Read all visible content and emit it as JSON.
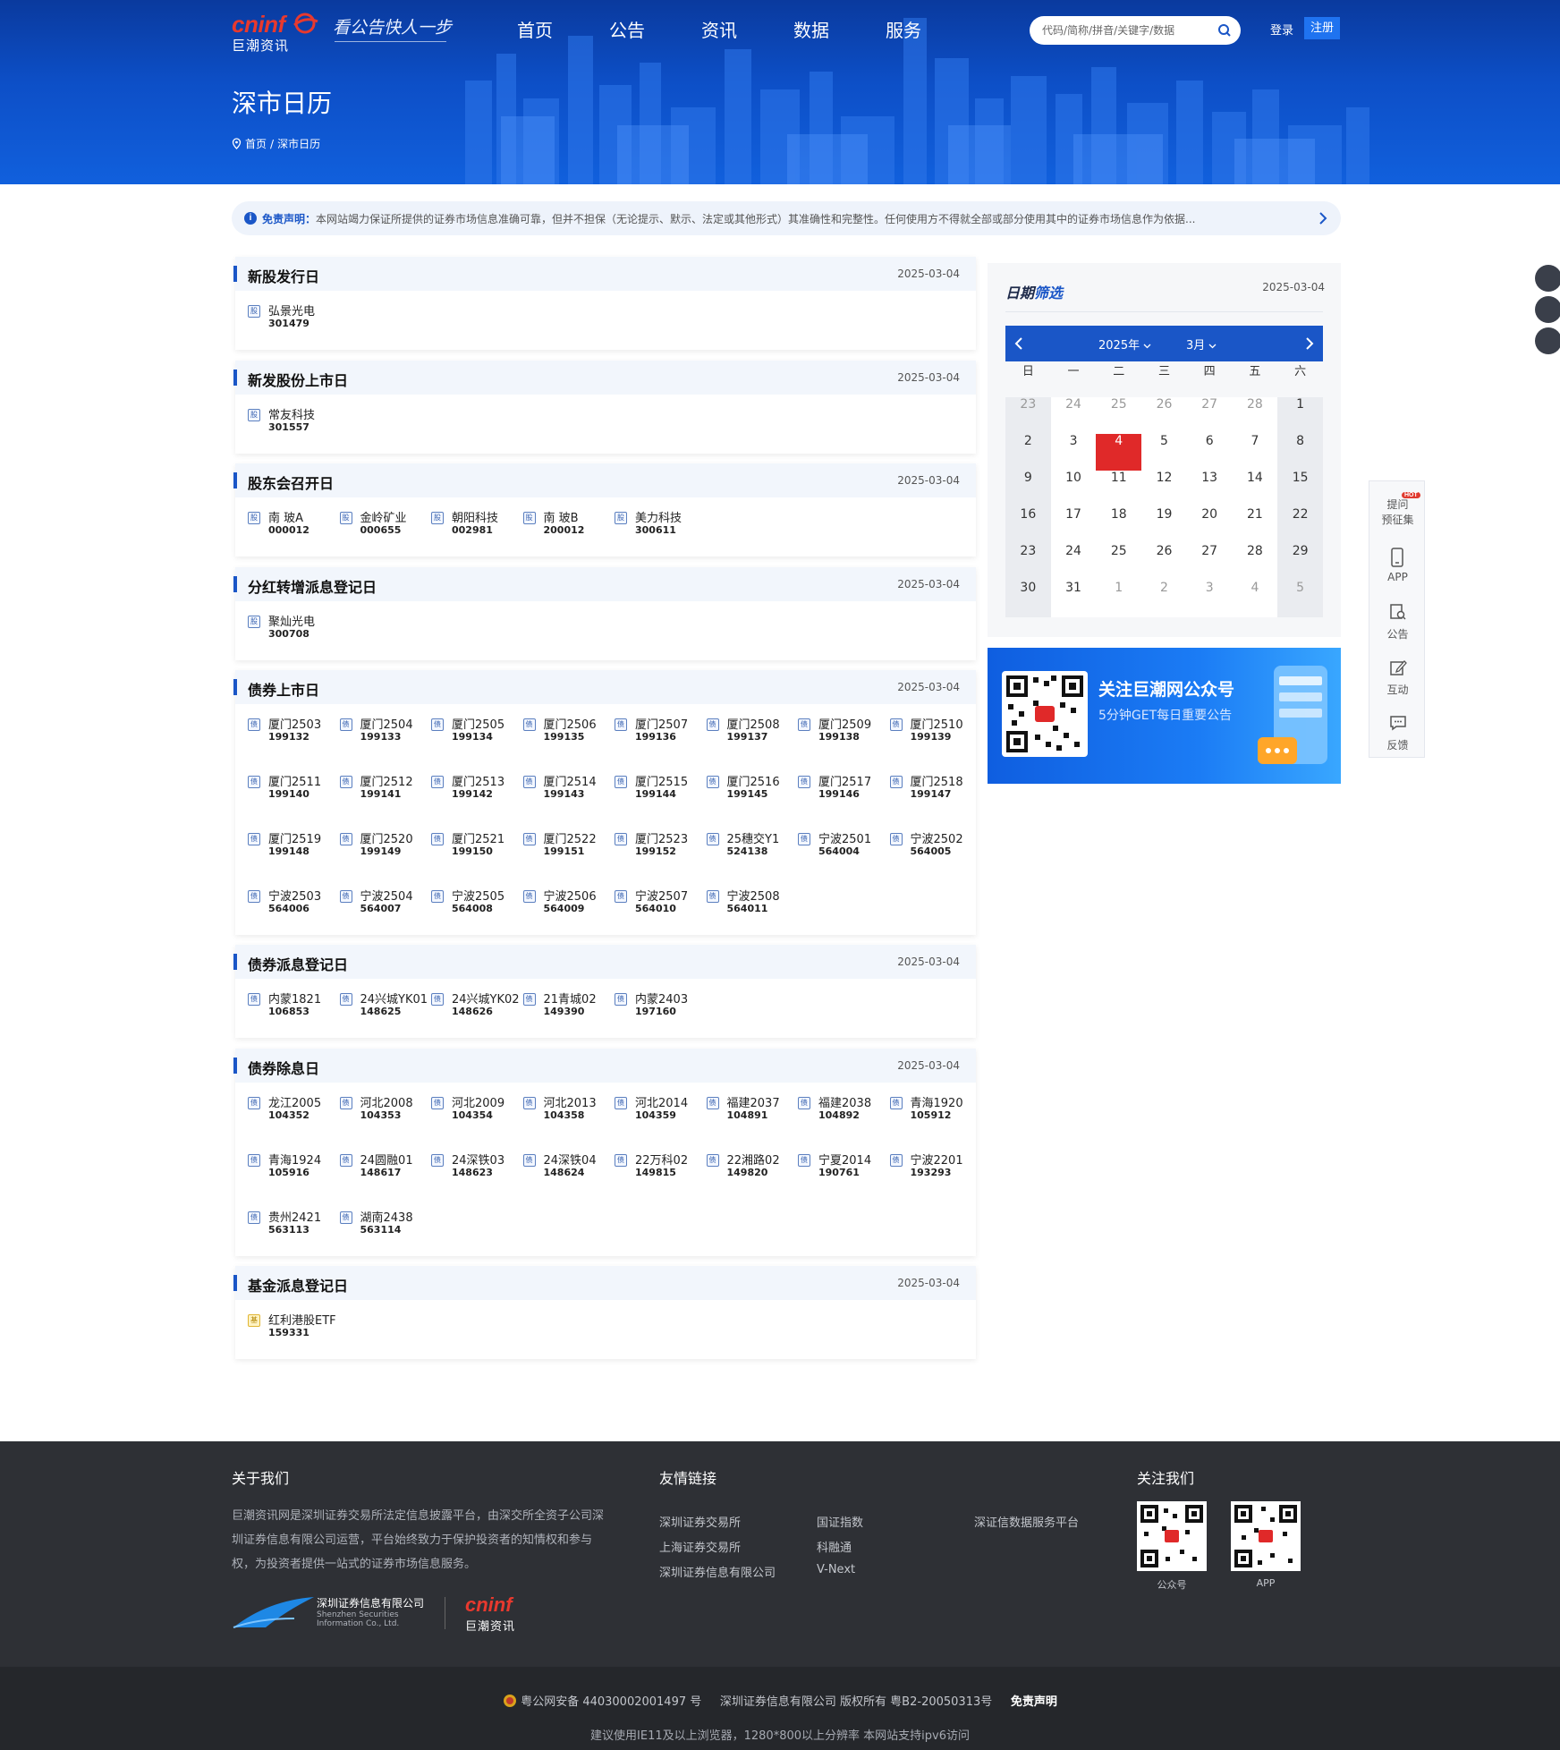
{
  "header": {
    "logo_text": "cninf",
    "logo_sub": "巨潮资讯",
    "slogan": "看公告快人一步",
    "nav": [
      "首页",
      "公告",
      "资讯",
      "数据",
      "服务"
    ],
    "search_placeholder": "代码/简称/拼音/关键字/数据",
    "login": "登录",
    "register": "注册",
    "page_title": "深市日历",
    "breadcrumb": {
      "home": "首页",
      "sep": "/",
      "current": "深市日历"
    }
  },
  "disclaimer": {
    "label": "免责声明：",
    "text": "本网站竭力保证所提供的证券市场信息准确可靠，但并不担保（无论提示、默示、法定或其他形式）其准确性和完整性。任何使用方不得就全部或部分使用其中的证券市场信息作为依据..."
  },
  "sections": [
    {
      "title": "新股发行日",
      "date": "2025-03-04",
      "tag": "股",
      "items": [
        {
          "name": "弘景光电",
          "code": "301479"
        }
      ]
    },
    {
      "title": "新发股份上市日",
      "date": "2025-03-04",
      "tag": "股",
      "items": [
        {
          "name": "常友科技",
          "code": "301557"
        }
      ]
    },
    {
      "title": "股东会召开日",
      "date": "2025-03-04",
      "tag": "股",
      "items": [
        {
          "name": "南 玻A",
          "code": "000012"
        },
        {
          "name": "金岭矿业",
          "code": "000655"
        },
        {
          "name": "朝阳科技",
          "code": "002981"
        },
        {
          "name": "南 玻B",
          "code": "200012"
        },
        {
          "name": "美力科技",
          "code": "300611"
        }
      ]
    },
    {
      "title": "分红转增派息登记日",
      "date": "2025-03-04",
      "tag": "股",
      "items": [
        {
          "name": "聚灿光电",
          "code": "300708"
        }
      ]
    },
    {
      "title": "债券上市日",
      "date": "2025-03-04",
      "tag": "债",
      "items": [
        {
          "name": "厦门2503",
          "code": "199132"
        },
        {
          "name": "厦门2504",
          "code": "199133"
        },
        {
          "name": "厦门2505",
          "code": "199134"
        },
        {
          "name": "厦门2506",
          "code": "199135"
        },
        {
          "name": "厦门2507",
          "code": "199136"
        },
        {
          "name": "厦门2508",
          "code": "199137"
        },
        {
          "name": "厦门2509",
          "code": "199138"
        },
        {
          "name": "厦门2510",
          "code": "199139"
        },
        {
          "name": "厦门2511",
          "code": "199140"
        },
        {
          "name": "厦门2512",
          "code": "199141"
        },
        {
          "name": "厦门2513",
          "code": "199142"
        },
        {
          "name": "厦门2514",
          "code": "199143"
        },
        {
          "name": "厦门2515",
          "code": "199144"
        },
        {
          "name": "厦门2516",
          "code": "199145"
        },
        {
          "name": "厦门2517",
          "code": "199146"
        },
        {
          "name": "厦门2518",
          "code": "199147"
        },
        {
          "name": "厦门2519",
          "code": "199148"
        },
        {
          "name": "厦门2520",
          "code": "199149"
        },
        {
          "name": "厦门2521",
          "code": "199150"
        },
        {
          "name": "厦门2522",
          "code": "199151"
        },
        {
          "name": "厦门2523",
          "code": "199152"
        },
        {
          "name": "25穗交Y1",
          "code": "524138"
        },
        {
          "name": "宁波2501",
          "code": "564004"
        },
        {
          "name": "宁波2502",
          "code": "564005"
        },
        {
          "name": "宁波2503",
          "code": "564006"
        },
        {
          "name": "宁波2504",
          "code": "564007"
        },
        {
          "name": "宁波2505",
          "code": "564008"
        },
        {
          "name": "宁波2506",
          "code": "564009"
        },
        {
          "name": "宁波2507",
          "code": "564010"
        },
        {
          "name": "宁波2508",
          "code": "564011"
        }
      ]
    },
    {
      "title": "债券派息登记日",
      "date": "2025-03-04",
      "tag": "债",
      "items": [
        {
          "name": "内蒙1821",
          "code": "106853"
        },
        {
          "name": "24兴城YK01",
          "code": "148625"
        },
        {
          "name": "24兴城YK02",
          "code": "148626"
        },
        {
          "name": "21青城02",
          "code": "149390"
        },
        {
          "name": "内蒙2403",
          "code": "197160"
        }
      ]
    },
    {
      "title": "债券除息日",
      "date": "2025-03-04",
      "tag": "债",
      "items": [
        {
          "name": "龙江2005",
          "code": "104352"
        },
        {
          "name": "河北2008",
          "code": "104353"
        },
        {
          "name": "河北2009",
          "code": "104354"
        },
        {
          "name": "河北2013",
          "code": "104358"
        },
        {
          "name": "河北2014",
          "code": "104359"
        },
        {
          "name": "福建2037",
          "code": "104891"
        },
        {
          "name": "福建2038",
          "code": "104892"
        },
        {
          "name": "青海1920",
          "code": "105912"
        },
        {
          "name": "青海1924",
          "code": "105916"
        },
        {
          "name": "24圆融01",
          "code": "148617"
        },
        {
          "name": "24深铁03",
          "code": "148623"
        },
        {
          "name": "24深铁04",
          "code": "148624"
        },
        {
          "name": "22万科02",
          "code": "149815"
        },
        {
          "name": "22湘路02",
          "code": "149820"
        },
        {
          "name": "宁夏2014",
          "code": "190761"
        },
        {
          "name": "宁波2201",
          "code": "193293"
        },
        {
          "name": "贵州2421",
          "code": "563113"
        },
        {
          "name": "湖南2438",
          "code": "563114"
        }
      ]
    },
    {
      "title": "基金派息登记日",
      "date": "2025-03-04",
      "tag": "基",
      "tag_style": "fund",
      "items": [
        {
          "name": "红利港股ETF",
          "code": "159331"
        }
      ]
    }
  ],
  "calendar": {
    "title_a": "日期",
    "title_b": "筛选",
    "date": "2025-03-04",
    "year": "2025年",
    "month": "3月",
    "weekdays": [
      "日",
      "一",
      "二",
      "三",
      "四",
      "五",
      "六"
    ],
    "days": [
      "23",
      "24",
      "25",
      "26",
      "27",
      "28",
      "1",
      "2",
      "3",
      "4",
      "5",
      "6",
      "7",
      "8",
      "9",
      "10",
      "11",
      "12",
      "13",
      "14",
      "15",
      "16",
      "17",
      "18",
      "19",
      "20",
      "21",
      "22",
      "23",
      "24",
      "25",
      "26",
      "27",
      "28",
      "29",
      "30",
      "31",
      "1",
      "2",
      "3",
      "4",
      "5"
    ],
    "leading_other_month": 6,
    "trailing_other_month": 5,
    "selected_index": 9
  },
  "banner": {
    "title": "关注巨潮网公众号",
    "subtitle": "5分钟GET每日重要公告"
  },
  "floating": [
    {
      "label": "提问\n预征集",
      "hot": "HOT"
    },
    {
      "label": "APP"
    },
    {
      "label": "公告"
    },
    {
      "label": "互动"
    },
    {
      "label": "反馈"
    }
  ],
  "footer": {
    "about_title": "关于我们",
    "about_text": "巨潮资讯网是深圳证券交易所法定信息披露平台，由深交所全资子公司深圳证券信息有限公司运营，平台始终致力于保护投资者的知情权和参与权，为投资者提供一站式的证券市场信息服务。",
    "links_title": "友情链接",
    "links": [
      [
        "深圳证券交易所",
        "国证指数",
        "深证信数据服务平台"
      ],
      [
        "上海证券交易所",
        "科融通"
      ],
      [
        "深圳证券信息有限公司",
        "V-Next"
      ]
    ],
    "follow_title": "关注我们",
    "qr_labels": [
      "公众号",
      "APP"
    ],
    "szsi_cn": "深圳证券信息有限公司",
    "szsi_en1": "Shenzhen Securities",
    "szsi_en2": "Information Co., Ltd.",
    "copyright1": "粤公网安备 44030002001497 号",
    "copyright2": "深圳证券信息有限公司 版权所有 粤B2-20050313号",
    "disclaimer_link": "免责声明",
    "browser_note": "建议使用IE11及以上浏览器，1280*800以上分辨率 本网站支持ipv6访问"
  },
  "colors": {
    "brand_blue": "#1a56c7",
    "hero_blue": "#0d4fc7",
    "selected_red": "#e02929",
    "footer_bg": "#2e3035"
  }
}
